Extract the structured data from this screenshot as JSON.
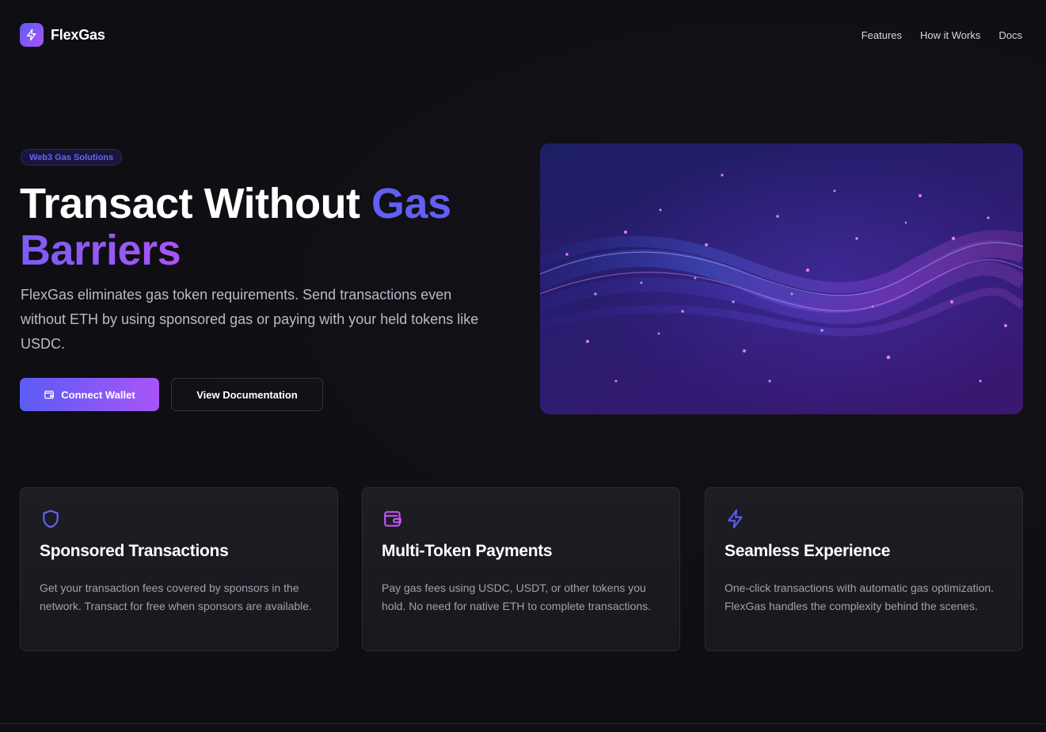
{
  "nav": {
    "brand": "FlexGas",
    "links": [
      "Features",
      "How it Works",
      "Docs"
    ]
  },
  "hero": {
    "badge": "Web3 Gas Solutions",
    "title_part1": "Transact Without ",
    "title_part2": "Gas",
    "title_part3": "Barriers",
    "description": "FlexGas eliminates gas token requirements. Send transactions even without ETH by using sponsored gas or paying with your held tokens like USDC.",
    "primary_button": "Connect Wallet",
    "secondary_button": "View Documentation"
  },
  "features": [
    {
      "icon": "shield-icon",
      "title": "Sponsored Transactions",
      "description": "Get your transaction fees covered by sponsors in the network. Transact for free when sponsors are available."
    },
    {
      "icon": "wallet-icon",
      "title": "Multi-Token Payments",
      "description": "Pay gas fees using USDC, USDT, or other tokens you hold. No need for native ETH to complete transactions."
    },
    {
      "icon": "lightning-icon",
      "title": "Seamless Experience",
      "description": "One-click transactions with automatic gas optimization. FlexGas handles the complexity behind the scenes."
    }
  ],
  "colors": {
    "background": "#0f0e12",
    "accent_indigo": "#6260f2",
    "accent_purple": "#a855f7",
    "card_border": "#2c2b33"
  }
}
